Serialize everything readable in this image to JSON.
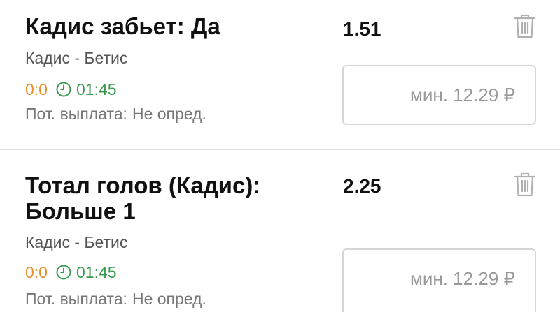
{
  "bets": [
    {
      "title": "Кадис забьет: Да",
      "odds": "1.51",
      "match": "Кадис - Бетис",
      "score": "0:0",
      "time": "01:45",
      "payout_label": "Пот. выплата:",
      "payout_value": "Не опред.",
      "stake_placeholder": "мин. 12.29 ₽"
    },
    {
      "title": "Тотал голов (Кадис): Больше 1",
      "odds": "2.25",
      "match": "Кадис - Бетис",
      "score": "0:0",
      "time": "01:45",
      "payout_label": "Пот. выплата:",
      "payout_value": "Не опред.",
      "stake_placeholder": "мин. 12.29 ₽"
    }
  ],
  "icons": {
    "delete": "trash-icon",
    "clock": "clock-icon"
  },
  "colors": {
    "score": "#e8902a",
    "time": "#3a9a4e",
    "divider": "#e0e0e0"
  }
}
